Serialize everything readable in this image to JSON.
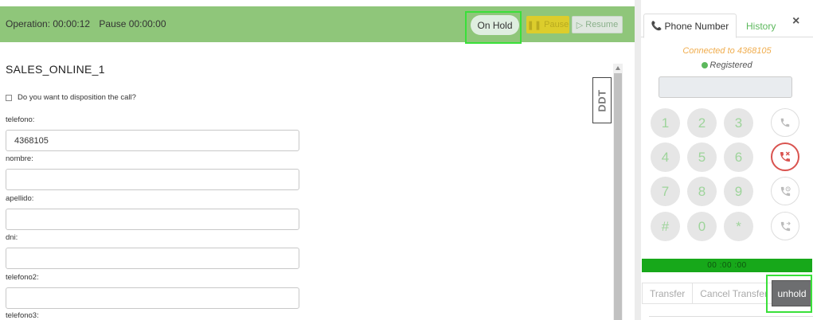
{
  "topbar": {
    "operation": "Operation: 00:00:12",
    "pause_time": "Pause 00:00:00",
    "on_hold_label": "On Hold",
    "pause_label": "Pause",
    "resume_label": "Resume"
  },
  "form": {
    "campaign": "SALES_ONLINE_1",
    "disposition_label": "Do you want to disposition the call?",
    "fields": [
      {
        "label": "telefono:",
        "value": "4368105"
      },
      {
        "label": "nombre:",
        "value": ""
      },
      {
        "label": "apellido:",
        "value": ""
      },
      {
        "label": "dni:",
        "value": ""
      },
      {
        "label": "telefono2:",
        "value": ""
      },
      {
        "label": "telefono3:",
        "value": ""
      }
    ],
    "logo_text": "DDT"
  },
  "phone": {
    "tab_phone": "Phone Number",
    "tab_history": "History",
    "close": "×",
    "connected": "Connected to 4368105",
    "registered": "Registered",
    "keys": [
      "1",
      "2",
      "3",
      "4",
      "5",
      "6",
      "7",
      "8",
      "9",
      "#",
      "0",
      "*"
    ],
    "actions": [
      "call-icon",
      "hangup-icon",
      "hold-icon",
      "transfer-icon"
    ],
    "timer": "00 :00 :00",
    "transfer_label": "Transfer",
    "cancel_transfer_label": "Cancel Transfer",
    "unhold_label": "unhold"
  },
  "colors": {
    "topbar_green": "#8fc67a",
    "accent_green": "#5cb85c",
    "progress_green": "#17a81a",
    "hangup_red": "#d9534f",
    "highlight": "#39e039"
  }
}
